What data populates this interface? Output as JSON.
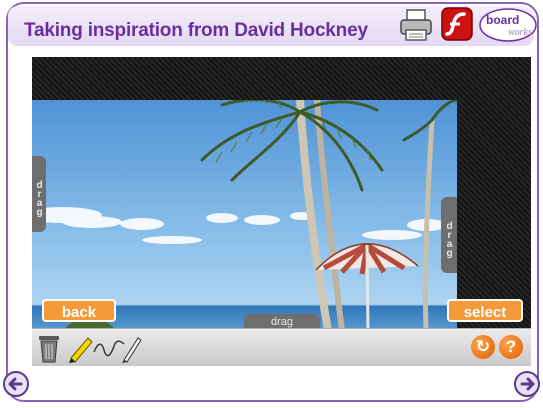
{
  "header": {
    "title": "Taking inspiration from David Hockney",
    "logo_text": "board",
    "logo_subtext": "works",
    "icons": [
      "print-icon",
      "flash-icon",
      "boardworks-logo"
    ]
  },
  "stage": {
    "drag_label": "drag",
    "back_label": "back",
    "select_label": "select"
  },
  "toolbar": {
    "tools": [
      "bin-icon",
      "highlighter-icon",
      "freehand-icon",
      "pen-icon"
    ],
    "reset_icon": "↻",
    "help_label": "?"
  },
  "navigation": {
    "prev_icon": "prev-arrow-icon",
    "next_icon": "next-arrow-icon"
  },
  "colors": {
    "title": "#6a2f9e",
    "frame": "#8a64b8",
    "button": "#f49a3a",
    "drag_tab": "#6e6e6e"
  }
}
